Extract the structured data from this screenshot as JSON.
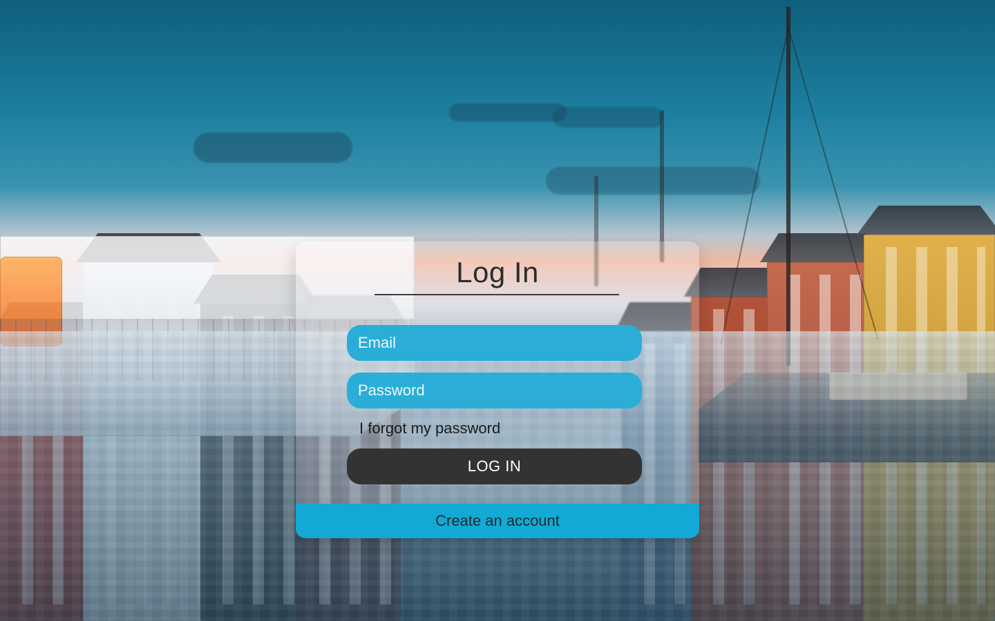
{
  "login": {
    "title": "Log In",
    "email_placeholder": "Email",
    "password_placeholder": "Password",
    "forgot_password": "I forgot my password",
    "login_button": "LOG IN",
    "create_account": "Create an account"
  },
  "colors": {
    "field_bg": "#2aaed7",
    "button_bg": "#333333",
    "create_bar_bg": "#12aad4"
  }
}
